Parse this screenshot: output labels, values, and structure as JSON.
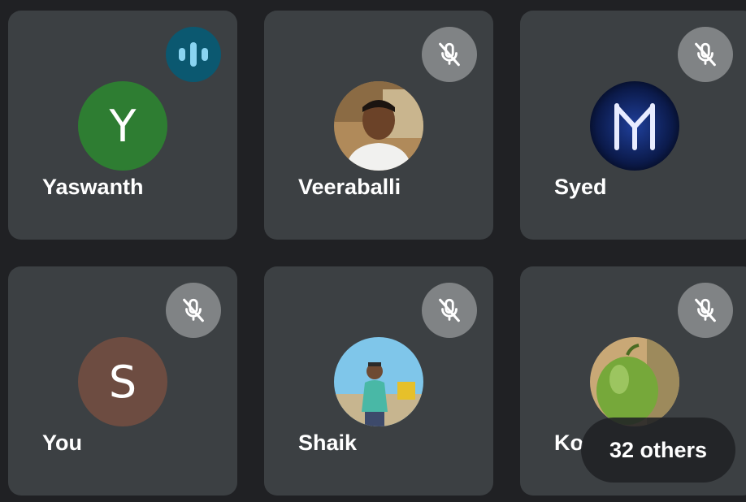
{
  "participants": [
    {
      "name": "Yaswanth",
      "initial": "Y",
      "avatar_color": "#2e7d32",
      "status": "speaking"
    },
    {
      "name": "Veeraballi",
      "initial": "",
      "status": "muted"
    },
    {
      "name": "Syed",
      "initial": "",
      "status": "muted"
    },
    {
      "name": "You",
      "initial": "S",
      "avatar_color": "#6d4c41",
      "status": "muted"
    },
    {
      "name": "Shaik",
      "initial": "",
      "status": "muted"
    },
    {
      "name": "Ko",
      "initial": "",
      "status": "muted"
    }
  ],
  "others": {
    "label": "32 others"
  },
  "icons": {
    "muted": "mic-off-icon",
    "speaking": "audio-level-icon"
  },
  "colors": {
    "background": "#202124",
    "tile": "#3c4043",
    "mute_badge": "#808385",
    "speak_badge": "#0b5870",
    "speak_bars": "#8ad4f1"
  }
}
